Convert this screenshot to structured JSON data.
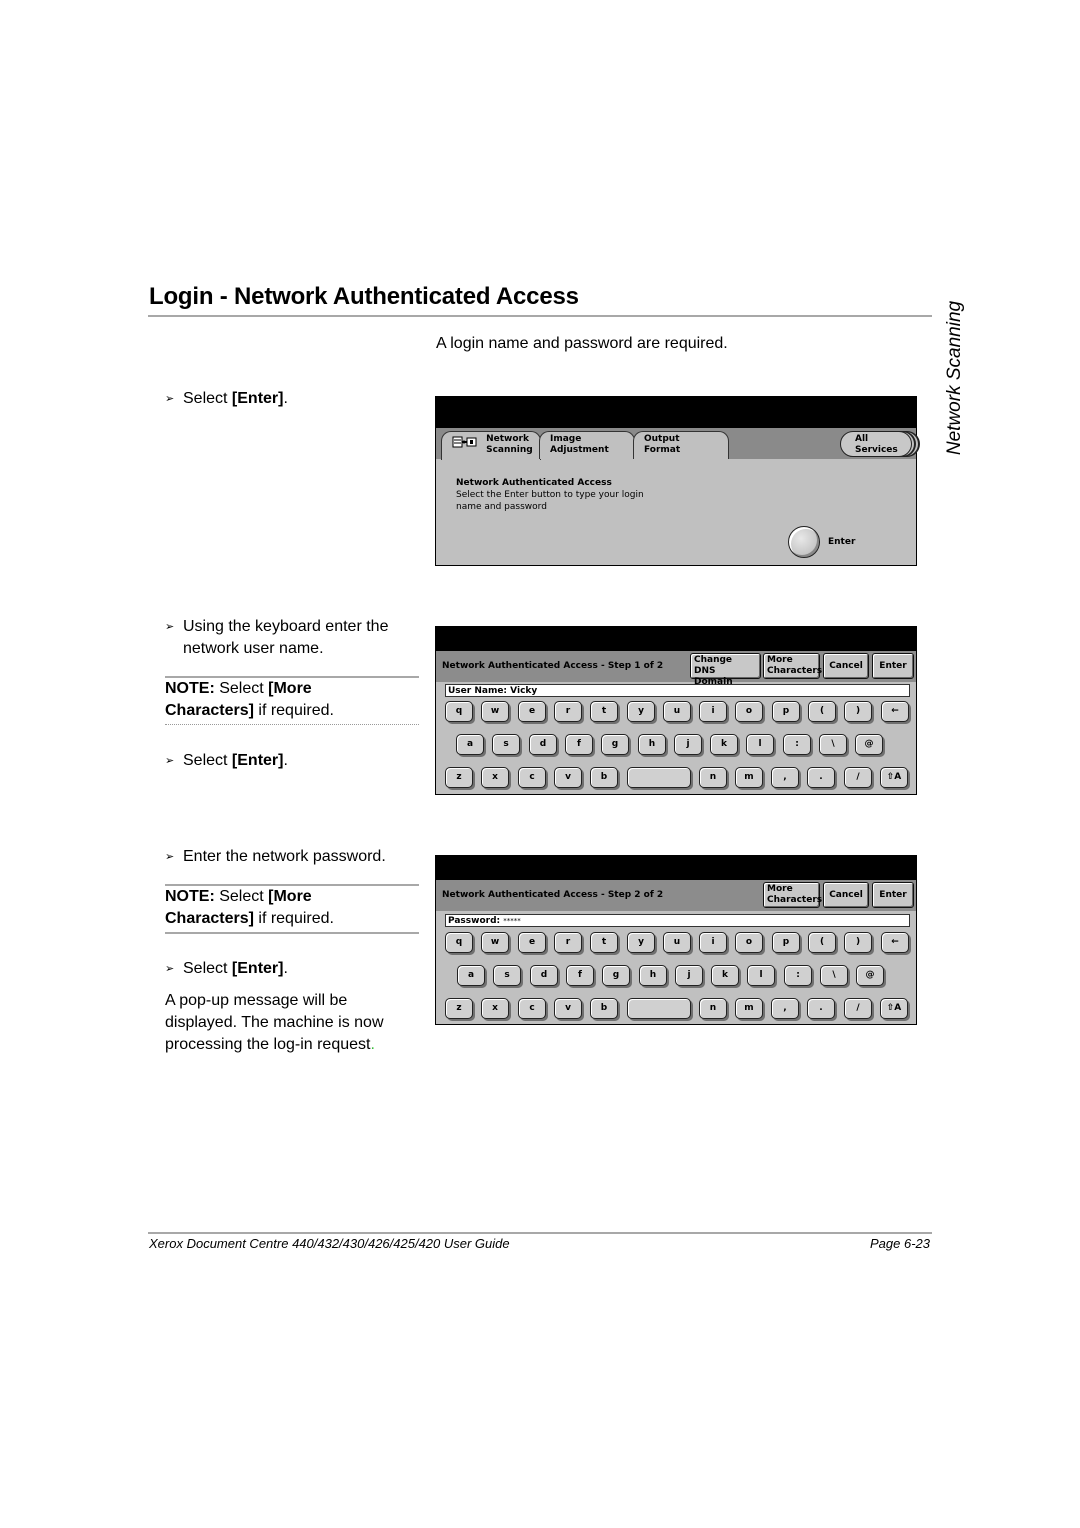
{
  "page": {
    "title": "Login - Network Authenticated Access",
    "side_tab": "Network Scanning",
    "intro": "A login name and password are required.",
    "footer_left": "Xerox Document Centre 440/432/430/426/425/420 User Guide",
    "footer_right": "Page 6-23"
  },
  "steps": {
    "s1": {
      "prefix": "Select ",
      "bold": "[Enter]",
      "suffix": "."
    },
    "s2": {
      "text_line1": "Using the keyboard enter the",
      "text_line2": "network user name."
    },
    "note1": {
      "label": "NOTE:",
      "t1": " Select ",
      "b1": "[More",
      "b2": "Characters]",
      "t2": " if required."
    },
    "s3": {
      "prefix": "Select ",
      "bold": "[Enter]",
      "suffix": "."
    },
    "s4": {
      "text": "Enter the network password."
    },
    "note2": {
      "label": "NOTE:",
      "t1": " Select ",
      "b1": "[More",
      "b2": "Characters]",
      "t2": " if required."
    },
    "s5": {
      "prefix": "Select ",
      "bold": "[Enter]",
      "suffix": "."
    },
    "closing": {
      "l1": "A pop-up message will be",
      "l2": "displayed. The machine is now",
      "l3": "processing the log-in request",
      "l4": "."
    }
  },
  "screen1": {
    "tabs": [
      {
        "l1": "Network",
        "l2": "Scanning"
      },
      {
        "l1": "Image",
        "l2": "Adjustment"
      },
      {
        "l1": "Output",
        "l2": "Format"
      }
    ],
    "all_services": {
      "l1": "All",
      "l2": "Services"
    },
    "heading": "Network Authenticated Access",
    "desc1": "Select the Enter button to type your login",
    "desc2": "name and password",
    "enter_label": "Enter"
  },
  "screen2": {
    "title": "Network Authenticated Access - Step 1 of 2",
    "change_dns": {
      "l1": "Change",
      "l2": "DNS Domain"
    },
    "more_chars": {
      "l1": "More",
      "l2": "Characters"
    },
    "cancel": "Cancel",
    "enter": "Enter",
    "field_label": "User Name: ",
    "field_value": "Vicky"
  },
  "screen3": {
    "title": "Network Authenticated Access - Step 2 of 2",
    "more_chars": {
      "l1": "More",
      "l2": "Characters"
    },
    "cancel": "Cancel",
    "enter": "Enter",
    "field_label": "Password: ",
    "field_value": "*****"
  },
  "keyboard": {
    "row1": [
      "q",
      "w",
      "e",
      "r",
      "t",
      "y",
      "u",
      "i",
      "o",
      "p",
      "(",
      ")",
      "←"
    ],
    "row2": [
      "a",
      "s",
      "d",
      "f",
      "g",
      "h",
      "j",
      "k",
      "l",
      ":",
      "\\",
      "@"
    ],
    "row3": [
      "z",
      "x",
      "c",
      "v",
      "b",
      "",
      "n",
      "m",
      ",",
      ".",
      "/",
      "⇧A"
    ]
  }
}
